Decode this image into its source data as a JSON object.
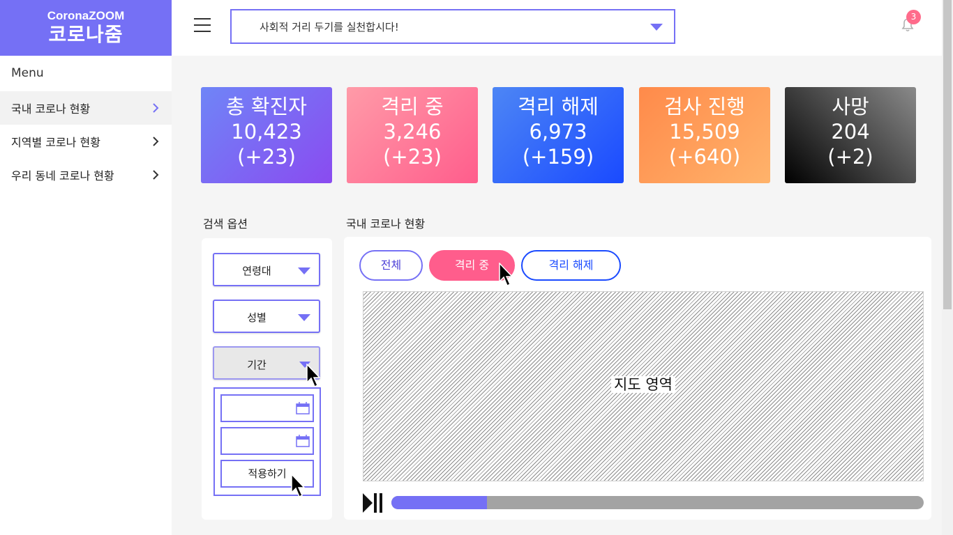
{
  "logo": {
    "top": "CoronaZOOM",
    "main": "코로나줌"
  },
  "sidebar": {
    "menu_title": "Menu",
    "items": [
      {
        "label": "국내 코로나 현황",
        "active": true
      },
      {
        "label": "지역별 코로나 현황",
        "active": false
      },
      {
        "label": "우리 동네 코로나 현황",
        "active": false
      }
    ]
  },
  "header": {
    "notice": "사회적 거리 두기를 실천합시다!",
    "notification_count": "3"
  },
  "stats": [
    {
      "title": "총 확진자",
      "value": "10,423",
      "delta": "(+23)"
    },
    {
      "title": "격리 중",
      "value": "3,246",
      "delta": "(+23)"
    },
    {
      "title": "격리 해제",
      "value": "6,973",
      "delta": "(+159)"
    },
    {
      "title": "검사 진행",
      "value": "15,509",
      "delta": "(+640)"
    },
    {
      "title": "사망",
      "value": "204",
      "delta": "(+2)"
    }
  ],
  "search": {
    "title": "검색 옵션",
    "age_label": "연령대",
    "gender_label": "성별",
    "period_label": "기간",
    "apply_label": "적용하기"
  },
  "main": {
    "title": "국내 코로나 현황",
    "tabs": [
      {
        "label": "전체"
      },
      {
        "label": "격리 중"
      },
      {
        "label": "격리 해제"
      }
    ],
    "map_label": "지도 영역",
    "timeline_progress_percent": 18
  },
  "colors": {
    "accent": "#7570f5",
    "pink": "#ff5d8c",
    "blue": "#1a4aff",
    "badge": "#ff6b8b"
  },
  "icons": [
    "menu-icon",
    "chevron-down-icon",
    "bell-icon",
    "chevron-right-icon",
    "calendar-icon",
    "play-pause-icon",
    "cursor-icon"
  ]
}
